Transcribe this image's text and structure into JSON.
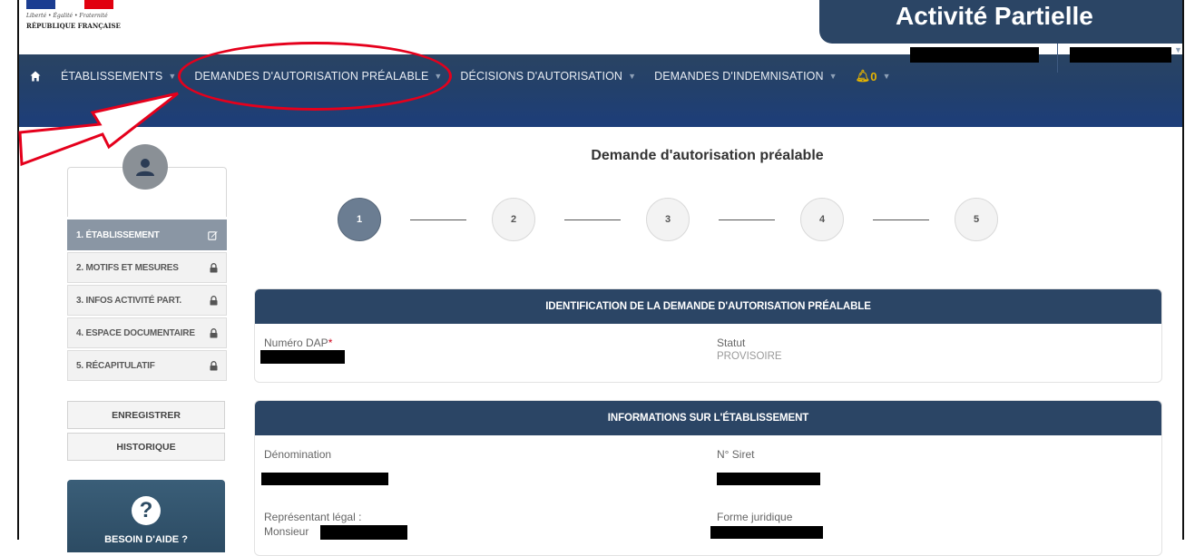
{
  "header": {
    "logo_line1": "Liberté • Égalité • Fraternité",
    "logo_line2": "RÉPUBLIQUE FRANÇAISE",
    "app_title": "Activité Partielle",
    "flag_colors": [
      "#1b3d91",
      "#ffffff",
      "#e1000f"
    ]
  },
  "nav": {
    "home_icon": "home-icon",
    "items": [
      {
        "label": "ÉTABLISSEMENTS"
      },
      {
        "label": "DEMANDES D'AUTORISATION PRÉALABLE"
      },
      {
        "label": "DÉCISIONS D'AUTORISATION"
      },
      {
        "label": "DEMANDES D'INDEMNISATION"
      }
    ],
    "alerts_count": "0"
  },
  "sidebar": {
    "steps": [
      {
        "label": "1. ÉTABLISSEMENT",
        "icon": "edit-icon",
        "active": true
      },
      {
        "label": "2. MOTIFS ET MESURES",
        "icon": "lock-icon",
        "active": false
      },
      {
        "label": "3. INFOS ACTIVITÉ PART.",
        "icon": "lock-icon",
        "active": false
      },
      {
        "label": "4. ESPACE DOCUMENTAIRE",
        "icon": "lock-icon",
        "active": false
      },
      {
        "label": "5. RÉCAPITULATIF",
        "icon": "lock-icon",
        "active": false
      }
    ],
    "save_label": "ENREGISTRER",
    "history_label": "HISTORIQUE",
    "help_label": "BESOIN D'AIDE ?"
  },
  "main": {
    "title": "Demande d'autorisation préalable",
    "stepper": [
      "1",
      "2",
      "3",
      "4",
      "5"
    ],
    "current_step": 1,
    "panel1": {
      "title": "IDENTIFICATION DE LA DEMANDE D'AUTORISATION PRÉALABLE",
      "numero_label": "Numéro DAP",
      "required_mark": "*",
      "statut_label": "Statut",
      "statut_value": "PROVISOIRE"
    },
    "panel2": {
      "title": "INFORMATIONS SUR L'ÉTABLISSEMENT",
      "denomination_label": "Dénomination",
      "siret_label": "N° Siret",
      "representant_label": "Représentant légal :",
      "representant_prefix": "Monsieur",
      "forme_label": "Forme juridique"
    }
  },
  "colors": {
    "navbar": "#2a4463",
    "panel_header": "#2b4565",
    "annotation": "#e5001c",
    "active_step": "#6b7d92"
  }
}
